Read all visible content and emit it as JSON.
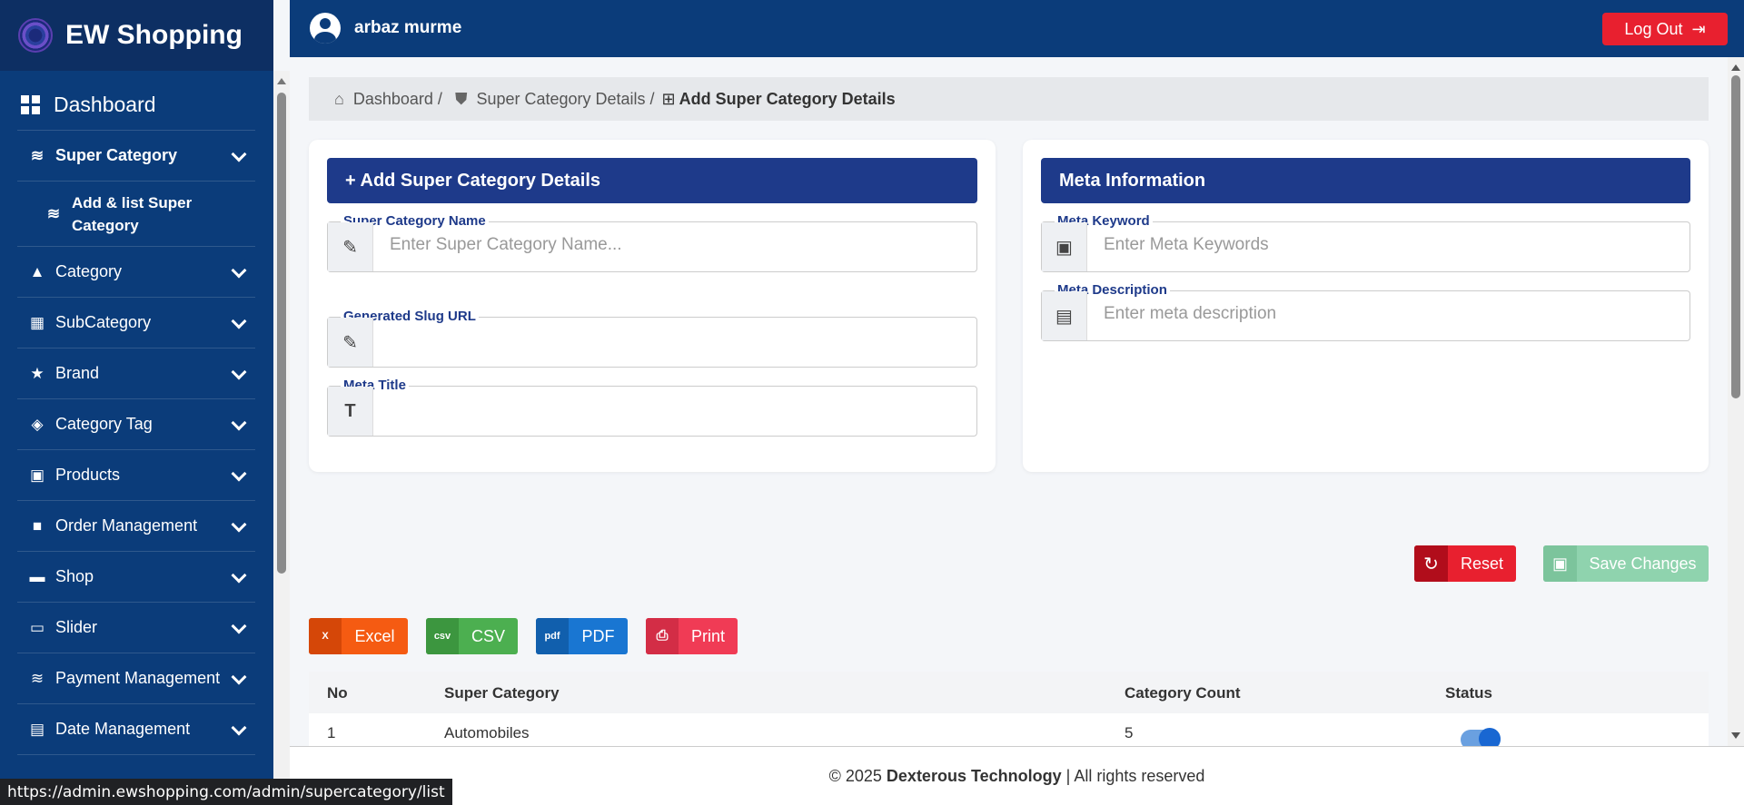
{
  "brand": {
    "name": "EW Shopping"
  },
  "header": {
    "user_name": "arbaz murme",
    "logout_label": "Log Out"
  },
  "sidebar": {
    "dashboard_label": "Dashboard",
    "items": [
      {
        "label": "Super Category",
        "icon": "layers-icon"
      },
      {
        "label": "Category",
        "icon": "shapes-icon"
      },
      {
        "label": "SubCategory",
        "icon": "boxes-icon"
      },
      {
        "label": "Brand",
        "icon": "star-icon"
      },
      {
        "label": "Category Tag",
        "icon": "tags-icon"
      },
      {
        "label": "Products",
        "icon": "box-open-icon"
      },
      {
        "label": "Order Management",
        "icon": "truck-icon"
      },
      {
        "label": "Shop",
        "icon": "store-icon"
      },
      {
        "label": "Slider",
        "icon": "images-icon"
      },
      {
        "label": "Payment Management",
        "icon": "layers-icon"
      },
      {
        "label": "Date Management",
        "icon": "calendar-icon"
      }
    ],
    "sub_item_label": "Add & list Super Category"
  },
  "breadcrumb": {
    "home": "Dashboard /",
    "parent": "Super Category Details /",
    "current": "Add Super Category Details"
  },
  "form": {
    "title": "+ Add Super Category Details",
    "name_label": "Super Category Name",
    "name_placeholder": "Enter Super Category Name...",
    "slug_label": "Generated Slug URL",
    "meta_title_label": "Meta Title"
  },
  "meta": {
    "title": "Meta Information",
    "keyword_label": "Meta Keyword",
    "keyword_placeholder": "Enter Meta Keywords",
    "description_label": "Meta Description",
    "description_placeholder": "Enter meta description"
  },
  "actions": {
    "reset_label": "Reset",
    "save_label": "Save Changes"
  },
  "export": {
    "excel": "Excel",
    "csv": "CSV",
    "pdf": "PDF",
    "print": "Print"
  },
  "table": {
    "columns": [
      "No",
      "Super Category",
      "Category Count",
      "Status"
    ],
    "rows": [
      {
        "no": "1",
        "name": "Automobiles",
        "count": "5",
        "status": "on"
      }
    ]
  },
  "footer": {
    "copy": "© 2025",
    "company": "Dexterous Technology",
    "rights": "| All rights reserved"
  },
  "status_bar": {
    "url": "https://admin.ewshopping.com/admin/supercategory/list"
  },
  "colors": {
    "sidebar": "#0b3c7a",
    "card_head": "#1e3a8a",
    "danger": "#e8202f",
    "success": "#8fd3ae"
  }
}
